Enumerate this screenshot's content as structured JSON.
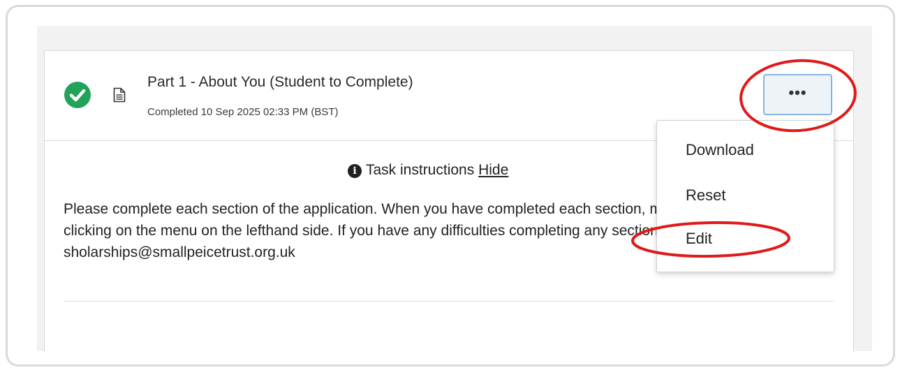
{
  "task": {
    "title": "Part 1 - About You (Student to Complete)",
    "status": "Completed 10 Sep 2025 02:33 PM (BST)",
    "more_button_label": "•••"
  },
  "instructions": {
    "label": "Task instructions",
    "toggle": "Hide",
    "info_symbol": "i",
    "body": "Please complete each section of the application. When you have completed each section, move to the next section by clicking on the menu on the lefthand side. If you have any difficulties completing any sections please email sholarships@smallpeicetrust.org.uk"
  },
  "menu": {
    "items": [
      "Download",
      "Reset",
      "Edit"
    ]
  },
  "colors": {
    "check": "#21a35a",
    "annotation": "#e01a1a",
    "button_border": "#87b4e3"
  },
  "icons": [
    "check-circle-icon",
    "document-icon",
    "info-icon",
    "more-icon"
  ]
}
